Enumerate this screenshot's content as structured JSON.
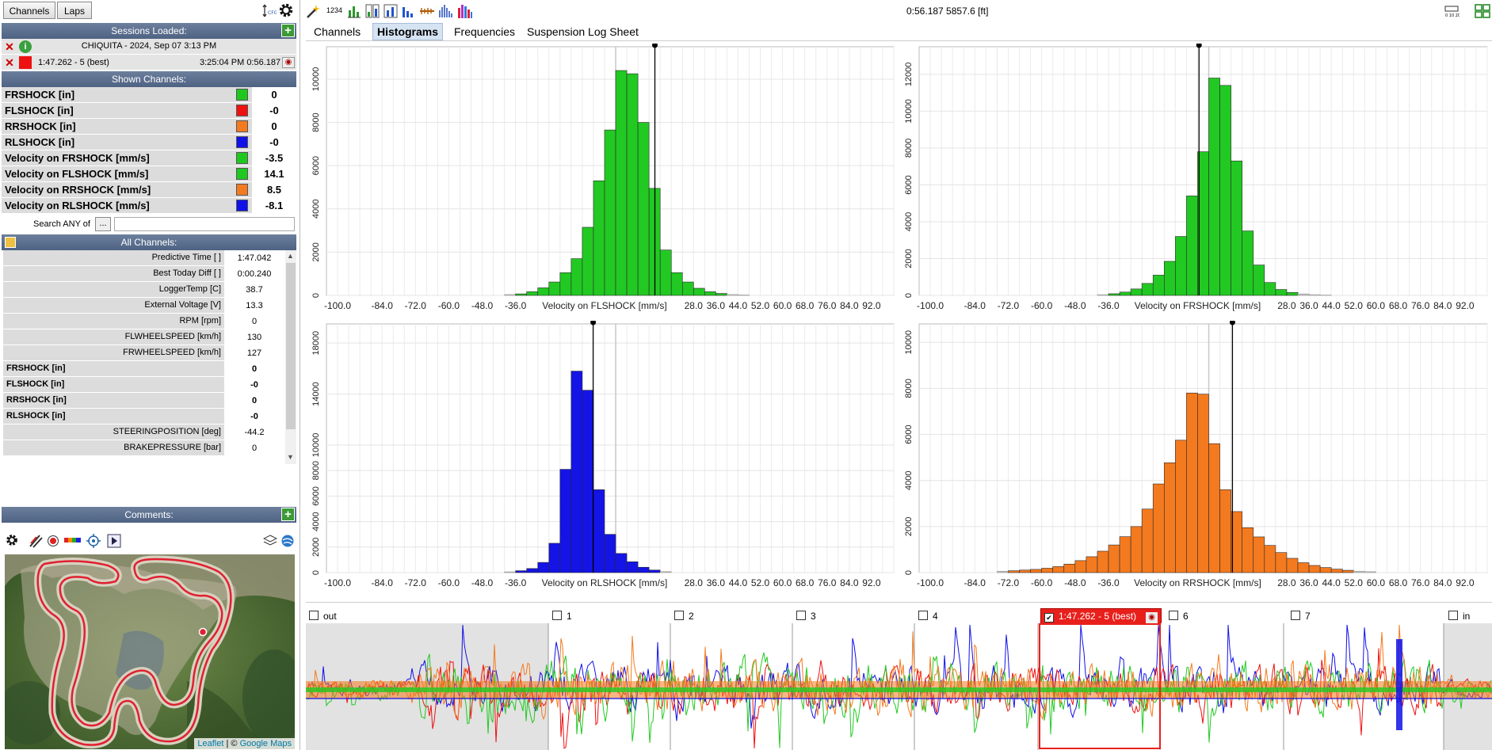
{
  "left": {
    "buttons": {
      "channels": "Channels",
      "laps": "Laps"
    },
    "sessions_header": "Sessions Loaded:",
    "session_row": "CHIQUITA  - 2024, Sep 07 3:13 PM",
    "lap_row": {
      "lap": "1:47.262 - 5 (best)",
      "time": "3:25:04 PM 0:56.187"
    },
    "shown_header": "Shown Channels:",
    "shown_channels": [
      {
        "name": "FRSHOCK [in]",
        "color": "#1ec81e",
        "value": "0"
      },
      {
        "name": "FLSHOCK [in]",
        "color": "#ee1111",
        "value": "-0"
      },
      {
        "name": "RRSHOCK [in]",
        "color": "#f47a1f",
        "value": "0"
      },
      {
        "name": "RLSHOCK [in]",
        "color": "#1010e8",
        "value": "-0"
      },
      {
        "name": "Velocity on FRSHOCK [mm/s]",
        "color": "#1ec81e",
        "value": "-3.5"
      },
      {
        "name": "Velocity on FLSHOCK [mm/s]",
        "color": "#1ec81e",
        "value": "14.1"
      },
      {
        "name": "Velocity on RRSHOCK [mm/s]",
        "color": "#f47a1f",
        "value": "8.5"
      },
      {
        "name": "Velocity on RLSHOCK [mm/s]",
        "color": "#1010e8",
        "value": "-8.1"
      }
    ],
    "search_label": "Search ANY of",
    "search_button": "...",
    "all_header": "All Channels:",
    "all_channels": [
      {
        "name": "Predictive Time [ ]",
        "value": "1:47.042",
        "bold": false
      },
      {
        "name": "Best Today Diff [ ]",
        "value": "0:00.240",
        "bold": false
      },
      {
        "name": "LoggerTemp [C]",
        "value": "38.7",
        "bold": false
      },
      {
        "name": "External Voltage [V]",
        "value": "13.3",
        "bold": false
      },
      {
        "name": "RPM [rpm]",
        "value": "0",
        "bold": false
      },
      {
        "name": "FLWHEELSPEED [km/h]",
        "value": "130",
        "bold": false
      },
      {
        "name": "FRWHEELSPEED [km/h]",
        "value": "127",
        "bold": false
      },
      {
        "name": "FRSHOCK [in]",
        "value": "0",
        "bold": true
      },
      {
        "name": "FLSHOCK [in]",
        "value": "-0",
        "bold": true
      },
      {
        "name": "RRSHOCK [in]",
        "value": "0",
        "bold": true
      },
      {
        "name": "RLSHOCK [in]",
        "value": "-0",
        "bold": true
      },
      {
        "name": "STEERINGPOSITION [deg]",
        "value": "-44.2",
        "bold": false
      },
      {
        "name": "BRAKEPRESSURE [bar]",
        "value": "0",
        "bold": false
      }
    ],
    "comments_header": "Comments:",
    "map_attribution": {
      "leaflet": "Leaflet",
      "sep": " | © ",
      "provider": "Google Maps"
    }
  },
  "toolbar": {
    "counter": "1234",
    "readout": "0:56.187 5857.6 [ft]"
  },
  "tabs": [
    {
      "label": "Channels",
      "active": false
    },
    {
      "label": "Histograms",
      "active": true
    },
    {
      "label": "Frequencies",
      "active": false
    },
    {
      "label": "Suspension Log Sheet",
      "active": false
    }
  ],
  "laps": [
    {
      "label": "out",
      "checked": false
    },
    {
      "label": "1",
      "checked": false
    },
    {
      "label": "2",
      "checked": false
    },
    {
      "label": "3",
      "checked": false
    },
    {
      "label": "4",
      "checked": false
    },
    {
      "label": "1:47.262 - 5 (best)",
      "checked": true,
      "highlight": true
    },
    {
      "label": "6",
      "checked": false
    },
    {
      "label": "7",
      "checked": false
    },
    {
      "label": "in",
      "checked": false
    }
  ],
  "chart_data": [
    {
      "type": "bar",
      "xlabel": "Velocity on FLSHOCK [mm/s]",
      "color": "#22c922",
      "x_ticks": [
        "-100.0",
        "-84.0",
        "-72.0",
        "-60.0",
        "-48.0",
        "-36.0",
        "28.0",
        "36.0",
        "44.0",
        "52.0",
        "60.0",
        "68.0",
        "76.0",
        "84.0",
        "92.0"
      ],
      "y_ticks": [
        0,
        2000,
        4000,
        6000,
        8000,
        10000
      ],
      "ylim": [
        0,
        11500
      ],
      "xlim": [
        -104,
        100
      ],
      "bin_start": -40,
      "bin_width": 4,
      "values": [
        40,
        70,
        170,
        350,
        620,
        1050,
        1700,
        3150,
        5300,
        7650,
        10400,
        10250,
        8000,
        4950,
        2100,
        1050,
        620,
        330,
        170,
        90,
        40,
        20
      ],
      "cursor_x": 14.1
    },
    {
      "type": "bar",
      "xlabel": "Velocity on FRSHOCK [mm/s]",
      "color": "#22c922",
      "x_ticks": [
        "-100.0",
        "-84.0",
        "-72.0",
        "-60.0",
        "-48.0",
        "-36.0",
        "28.0",
        "36.0",
        "44.0",
        "52.0",
        "60.0",
        "68.0",
        "76.0",
        "84.0",
        "92.0"
      ],
      "y_ticks": [
        0,
        2000,
        4000,
        6000,
        8000,
        10000,
        12000
      ],
      "ylim": [
        0,
        13500
      ],
      "xlim": [
        -104,
        100
      ],
      "bin_start": -40,
      "bin_width": 4,
      "values": [
        40,
        90,
        180,
        350,
        650,
        1100,
        1850,
        3200,
        5400,
        7800,
        11800,
        11400,
        7300,
        3500,
        1650,
        700,
        320,
        160,
        80,
        40,
        20
      ],
      "cursor_x": -3.5
    },
    {
      "type": "bar",
      "xlabel": "Velocity on RLSHOCK [mm/s]",
      "color": "#1414e6",
      "x_ticks": [
        "-100.0",
        "-84.0",
        "-72.0",
        "-60.0",
        "-48.0",
        "-36.0",
        "28.0",
        "36.0",
        "44.0",
        "52.0",
        "60.0",
        "68.0",
        "76.0",
        "84.0",
        "92.0"
      ],
      "y_ticks": [
        0,
        2000,
        4000,
        6000,
        8000,
        10000,
        14000,
        18000
      ],
      "ylim": [
        0,
        19500
      ],
      "xlim": [
        -104,
        100
      ],
      "bin_start": -40,
      "bin_width": 4,
      "values": [
        60,
        150,
        320,
        800,
        2300,
        8100,
        15800,
        14300,
        6500,
        3000,
        1500,
        850,
        420,
        200,
        80
      ],
      "cursor_x": -8.1
    },
    {
      "type": "bar",
      "xlabel": "Velocity on RRSHOCK [mm/s]",
      "color": "#f47a1f",
      "x_ticks": [
        "-100.0",
        "-84.0",
        "-72.0",
        "-60.0",
        "-48.0",
        "-36.0",
        "28.0",
        "36.0",
        "44.0",
        "52.0",
        "60.0",
        "68.0",
        "76.0",
        "84.0",
        "92.0"
      ],
      "y_ticks": [
        0,
        2000,
        4000,
        6000,
        8000,
        10000
      ],
      "ylim": [
        0,
        10800
      ],
      "xlim": [
        -104,
        100
      ],
      "bin_start": -76,
      "bin_width": 4,
      "values": [
        60,
        80,
        110,
        140,
        190,
        260,
        370,
        520,
        690,
        930,
        1200,
        1560,
        2000,
        2760,
        3850,
        4770,
        5750,
        7800,
        7750,
        5600,
        3600,
        2650,
        1950,
        1550,
        1180,
        870,
        620,
        430,
        310,
        220,
        150,
        100,
        60,
        40
      ],
      "cursor_x": 8.5
    }
  ]
}
